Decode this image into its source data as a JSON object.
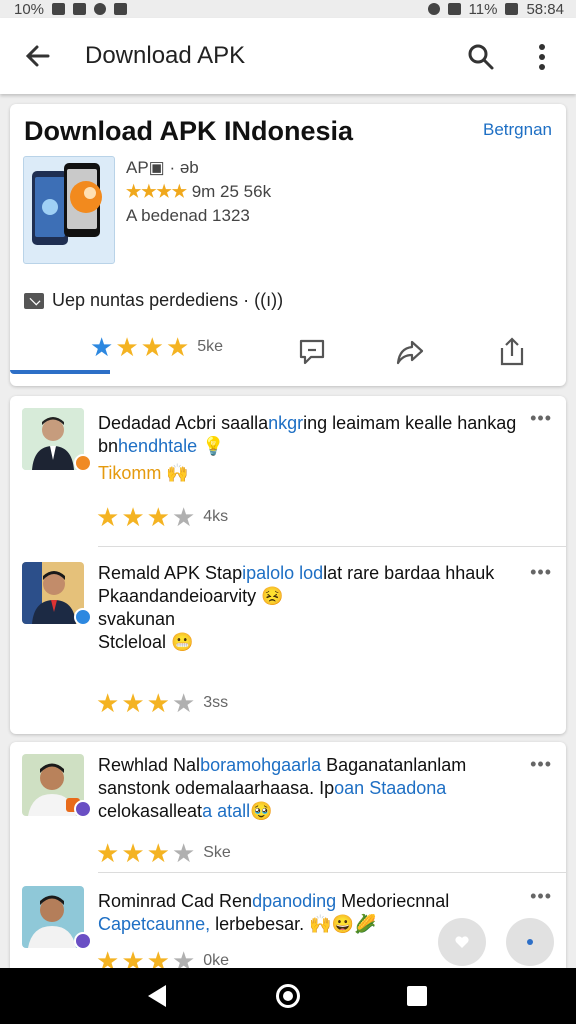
{
  "status_bar": {
    "battery_text": "10%",
    "time": "58:84",
    "signal_text": "11%"
  },
  "app_bar": {
    "title": "Download APK"
  },
  "app_card": {
    "title": "Download APK INdonesia",
    "link": "Betrgnan",
    "meta_line1": "AP▣ · əb",
    "meta_line2_stars": "★★★★",
    "meta_line2_text": "9m 25 56k",
    "meta_line3": "A bedenad 1323",
    "notice": "Uep nuntas perdediens · ((ı))",
    "rating_text": "5ke"
  },
  "reviews": [
    {
      "text_a": "Dedadad Acbri saalla",
      "text_b": "nkgr",
      "text_c": "ing leaimam kealle hankag bn",
      "text_d": "hendhtale",
      "text_e": " 💡",
      "tag": "Tikomm 🙌",
      "stars": 3,
      "rating_text": "4ks"
    },
    {
      "text_a": "Remald APK Stap",
      "text_b": "ipalolo lod",
      "text_c": "lat rare bardaa hhauk",
      "line2": "Pkaandandeioarvity 😣",
      "line3": "svakunan",
      "line4": "Stcleloal 😬",
      "stars": 3,
      "rating_text": "3ss"
    },
    {
      "text_a": "Rewhlad Nal",
      "text_b": "boramohgaarla",
      "text_c": " Baganatanlanlam sanstonk odemalaarhaasa. Ip",
      "text_d": "oan Staadona",
      "text_e": "celokasalleat",
      "text_f": "a atall",
      "text_g": "🥹",
      "stars": 3,
      "rating_text": "Ske"
    },
    {
      "text_a": "Rominrad Cad Ren",
      "text_b": "dpanoding",
      "text_c": " Medoriecnnal",
      "line2": "Capetcaunne,",
      "line2b": " lerbebesar. 🙌😀🌽",
      "stars": 3,
      "rating_text": "0ke"
    }
  ],
  "icons": [
    "back-arrow-icon",
    "search-icon",
    "more-vert-icon",
    "comment-icon",
    "share-icon",
    "export-icon",
    "more-horiz-icon"
  ],
  "colors": {
    "accent": "#1e6fc4",
    "star": "#f4b322",
    "star_blue": "#2d88e0"
  }
}
